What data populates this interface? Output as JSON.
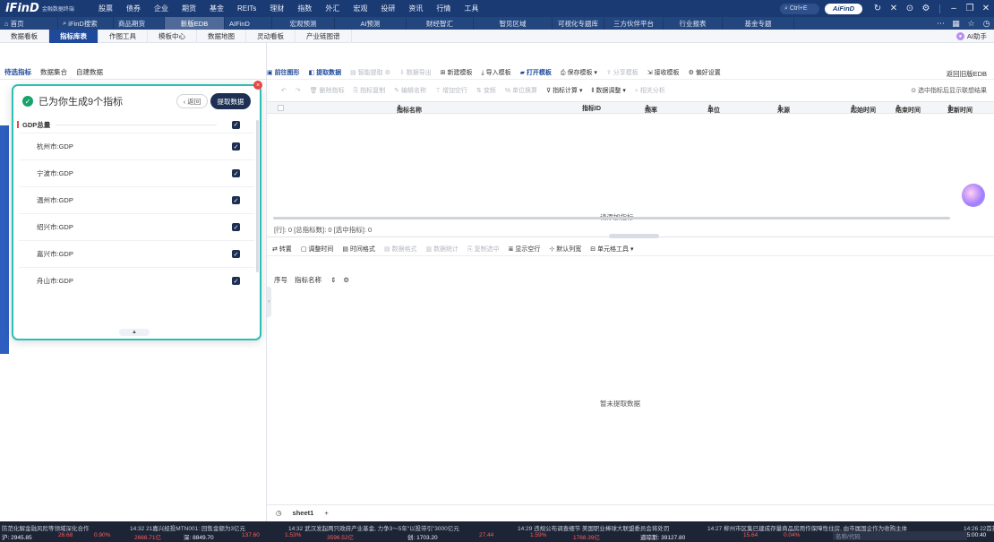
{
  "app": {
    "logo": "iFinD",
    "logo_sub": "金融数据终端",
    "menu": [
      "股票",
      "债券",
      "企业",
      "期货",
      "基金",
      "REITs",
      "理财",
      "指数",
      "外汇",
      "宏观",
      "投研",
      "资讯",
      "行情",
      "工具"
    ],
    "search_label": "Ctrl+E",
    "aifind_label": "AiFinD"
  },
  "tabrow": {
    "tabs": [
      "首页",
      "iFinD搜索",
      "商品期货",
      "新版EDB",
      "AIFinD",
      "宏观预测",
      "AI预测",
      "财经智汇",
      "智见区域",
      "可视化专题库",
      "三方伙伴平台",
      "行业报表",
      "基金专题"
    ]
  },
  "subtabs": {
    "items": [
      "数据看板",
      "指标库表",
      "作图工具",
      "模板中心",
      "数据地图",
      "灵动看板",
      "产业链图谱"
    ],
    "active": "指标库表",
    "ai_helper": "AI助手"
  },
  "left": {
    "tabs": [
      "待选指标",
      "数据集合",
      "自建数据"
    ]
  },
  "popup": {
    "title": "已为你生成9个指标",
    "back": "返回",
    "extract": "提取数据",
    "group": "GDP总量",
    "items": [
      "杭州市:GDP",
      "宁波市:GDP",
      "温州市:GDP",
      "绍兴市:GDP",
      "嘉兴市:GDP",
      "舟山市:GDP"
    ]
  },
  "toolbar1": {
    "items": [
      "前往图形",
      "提取数据",
      "智能提取",
      "数据导出",
      "新建模板",
      "导入模板",
      "打开模板",
      "保存模板",
      "分享模板",
      "接收模板",
      "偏好设置"
    ],
    "back_old": "返回旧版EDB"
  },
  "toolbar2": {
    "items": [
      "删除指标",
      "指标复制",
      "编辑名称",
      "增加空行",
      "变频",
      "单位换算",
      "指标计算",
      "数据调整",
      "相关分析"
    ],
    "hint": "选中指标后显示联想结果"
  },
  "table": {
    "headers": [
      "指标名称",
      "指标ID",
      "频率",
      "单位",
      "来源",
      "起始时间",
      "结束时间",
      "更新时间"
    ],
    "empty": "请添加指标"
  },
  "stats": "[行]: 0 [总指标数]: 0 [选中指标]: 0",
  "toolbar3": {
    "items": [
      "转置",
      "调整时间",
      "时间格式",
      "数据格式",
      "数据统计",
      "复制选中",
      "显示空行",
      "默认列宽",
      "单元格工具"
    ]
  },
  "data_table": {
    "seq": "序号",
    "name": "指标名称",
    "empty": "暂未提取数据"
  },
  "sheet": {
    "name": "sheet1",
    "add": "+"
  },
  "ticker": {
    "news": [
      "防范化解金融风险等领域深化合作",
      "14:32 21嘉兴经投MTN001: 回售金额为3亿元",
      "14:32 武汉发起两只政府产业基金, 力争3～5年“以投带引”3000亿元",
      "14:29 违规公布调查细节 美国职业棒球大联盟委员会将处罚",
      "14:27 柳州市区集已建成存量商品房用作保障性住房, 由市属国企作为收购主体",
      "14:26 22首投"
    ],
    "idx": [
      {
        "label": "沪: 2945.85",
        "chg": "26.68",
        "pct": "0.90%",
        "amt": "2666.71亿"
      },
      {
        "label": "深: 8849.70",
        "chg": "137.60",
        "pct": "1.53%",
        "amt": "3596.52亿"
      },
      {
        "label": "创: 1703.20",
        "chg": "27.44",
        "pct": "1.59%",
        "amt": "1768.39亿"
      },
      {
        "label": "道琼斯: 39127.80",
        "chg": "15.64",
        "pct": "0.04%",
        "amt": ""
      }
    ],
    "search_placeholder": "名称/代码",
    "time": "15:00:40"
  }
}
